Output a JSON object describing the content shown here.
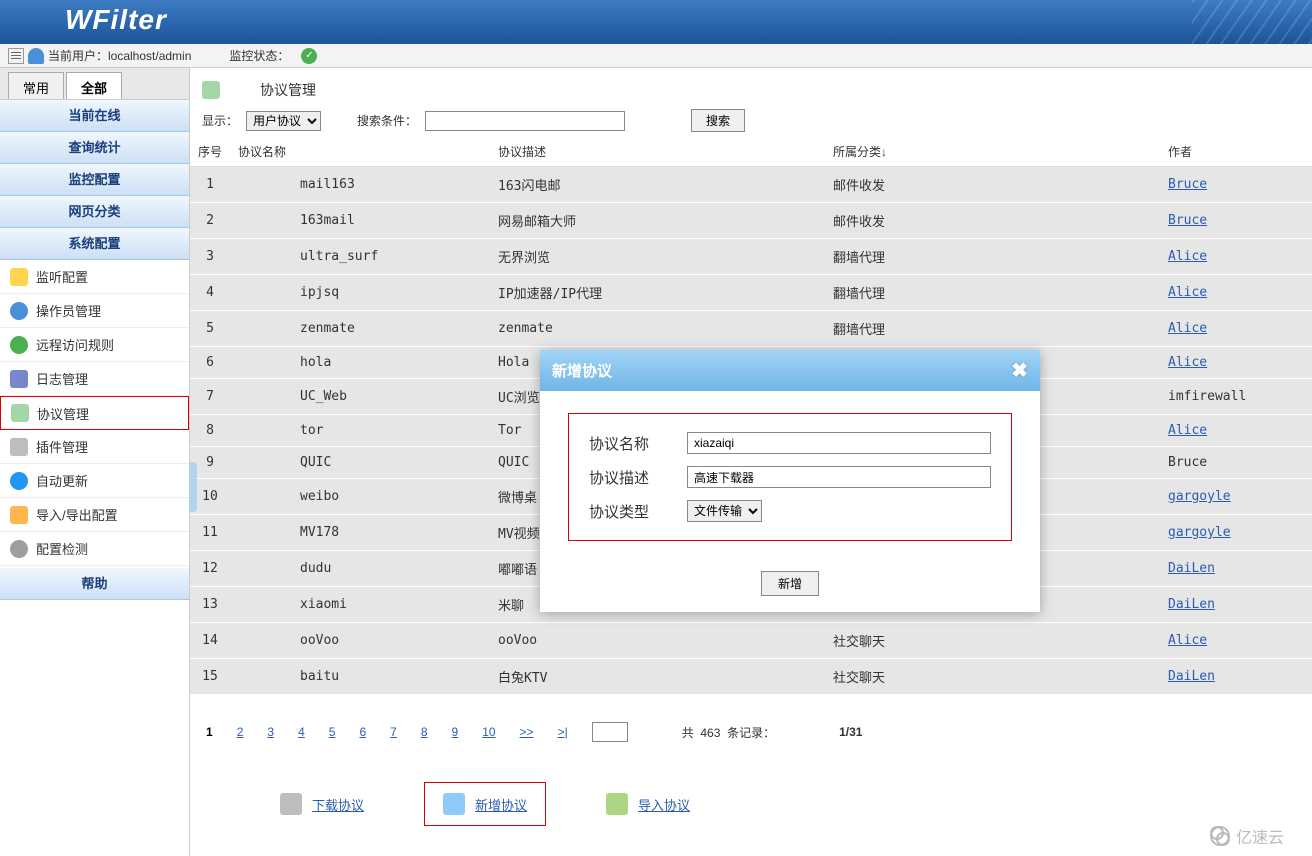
{
  "app": {
    "logo": "WFilter"
  },
  "statusbar": {
    "user_label": "当前用户：localhost/admin",
    "monitor_label": "监控状态："
  },
  "tabs": {
    "common": "常用",
    "all": "全部",
    "active": "all"
  },
  "nav_headers": [
    "当前在线",
    "查询统计",
    "监控配置",
    "网页分类",
    "系统配置"
  ],
  "nav_items": [
    {
      "label": "监听配置"
    },
    {
      "label": "操作员管理"
    },
    {
      "label": "远程访问规则"
    },
    {
      "label": "日志管理"
    },
    {
      "label": "协议管理",
      "selected": true
    },
    {
      "label": "插件管理"
    },
    {
      "label": "自动更新"
    },
    {
      "label": "导入/导出配置"
    },
    {
      "label": "配置检测"
    }
  ],
  "nav_help": "帮助",
  "content": {
    "title": "协议管理",
    "display_label": "显示：",
    "display_options": [
      "用户协议"
    ],
    "search_label": "搜索条件：",
    "search_value": "",
    "search_button": "搜索",
    "columns": [
      "序号",
      "协议名称",
      "协议描述",
      "所属分类↓",
      "作者"
    ],
    "rows": [
      {
        "no": "1",
        "name": "mail163",
        "desc": "163闪电邮",
        "cat": "邮件收发",
        "author": "Bruce",
        "link": true
      },
      {
        "no": "2",
        "name": "163mail",
        "desc": "网易邮箱大师",
        "cat": "邮件收发",
        "author": "Bruce",
        "link": true
      },
      {
        "no": "3",
        "name": "ultra_surf",
        "desc": "无界浏览",
        "cat": "翻墙代理",
        "author": "Alice",
        "link": true
      },
      {
        "no": "4",
        "name": "ipjsq",
        "desc": "IP加速器/IP代理",
        "cat": "翻墙代理",
        "author": "Alice",
        "link": true
      },
      {
        "no": "5",
        "name": "zenmate",
        "desc": "zenmate",
        "cat": "翻墙代理",
        "author": "Alice",
        "link": true
      },
      {
        "no": "6",
        "name": "hola",
        "desc": "Hola",
        "cat": "",
        "author": "Alice",
        "link": true
      },
      {
        "no": "7",
        "name": "UC_Web",
        "desc": "UC浏览",
        "cat": "",
        "author": "imfirewall",
        "link": false
      },
      {
        "no": "8",
        "name": "tor",
        "desc": "Tor",
        "cat": "",
        "author": "Alice",
        "link": true
      },
      {
        "no": "9",
        "name": "QUIC",
        "desc": "QUIC",
        "cat": "",
        "author": "Bruce",
        "link": false
      },
      {
        "no": "10",
        "name": "weibo",
        "desc": "微博桌",
        "cat": "",
        "author": "gargoyle",
        "link": true
      },
      {
        "no": "11",
        "name": "MV178",
        "desc": "MV视频",
        "cat": "",
        "author": "gargoyle",
        "link": true
      },
      {
        "no": "12",
        "name": "dudu",
        "desc": "嘟嘟语",
        "cat": "",
        "author": "DaiLen",
        "link": true
      },
      {
        "no": "13",
        "name": "xiaomi",
        "desc": "米聊",
        "cat": "社交聊天",
        "author": "DaiLen",
        "link": true
      },
      {
        "no": "14",
        "name": "ooVoo",
        "desc": "ooVoo",
        "cat": "社交聊天",
        "author": "Alice",
        "link": true
      },
      {
        "no": "15",
        "name": "baitu",
        "desc": "白兔KTV",
        "cat": "社交聊天",
        "author": "DaiLen",
        "link": true
      }
    ],
    "pager": {
      "pages": [
        "1",
        "2",
        "3",
        "4",
        "5",
        "6",
        "7",
        "8",
        "9",
        "10"
      ],
      "current": "1",
      "next": ">>",
      "last": ">|",
      "total_label_prefix": "共",
      "total_count": "463",
      "total_label_suffix": "条记录：",
      "page_pos": "1/31",
      "goto_value": ""
    },
    "actions": {
      "download": "下载协议",
      "add": "新增协议",
      "import": "导入协议"
    }
  },
  "dialog": {
    "title": "新增协议",
    "field_name": "协议名称",
    "field_name_value": "xiazaiqi",
    "field_desc": "协议描述",
    "field_desc_value": "高速下载器",
    "field_type": "协议类型",
    "field_type_value": "文件传输",
    "submit": "新增"
  },
  "watermark": "亿速云"
}
